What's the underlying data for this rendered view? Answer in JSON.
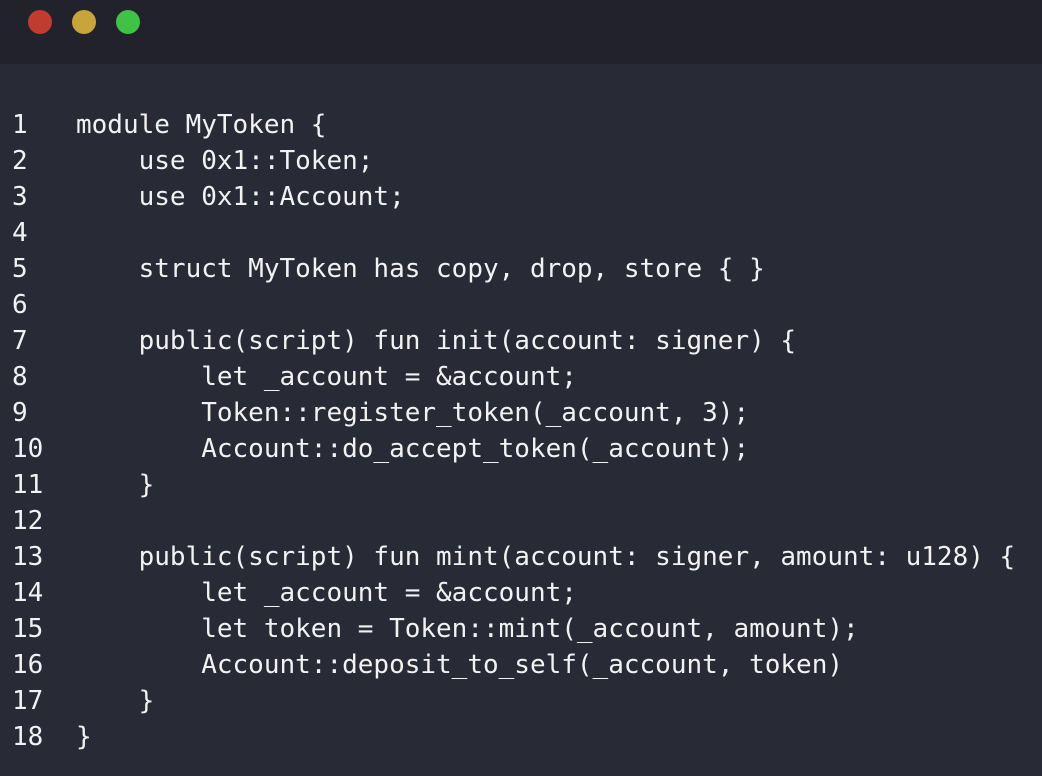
{
  "window": {
    "controls": [
      {
        "name": "close",
        "color": "#c23b30"
      },
      {
        "name": "minimize",
        "color": "#c9a43b"
      },
      {
        "name": "maximize",
        "color": "#3fc245"
      }
    ]
  },
  "code": {
    "lines": [
      {
        "number": "1",
        "text": "module MyToken {"
      },
      {
        "number": "2",
        "text": "    use 0x1::Token;"
      },
      {
        "number": "3",
        "text": "    use 0x1::Account;"
      },
      {
        "number": "4",
        "text": ""
      },
      {
        "number": "5",
        "text": "    struct MyToken has copy, drop, store { }"
      },
      {
        "number": "6",
        "text": ""
      },
      {
        "number": "7",
        "text": "    public(script) fun init(account: signer) {"
      },
      {
        "number": "8",
        "text": "        let _account = &account;"
      },
      {
        "number": "9",
        "text": "        Token::register_token(_account, 3);"
      },
      {
        "number": "10",
        "text": "        Account::do_accept_token(_account);"
      },
      {
        "number": "11",
        "text": "    }"
      },
      {
        "number": "12",
        "text": ""
      },
      {
        "number": "13",
        "text": "    public(script) fun mint(account: signer, amount: u128) {"
      },
      {
        "number": "14",
        "text": "        let _account = &account;"
      },
      {
        "number": "15",
        "text": "        let token = Token::mint(_account, amount);"
      },
      {
        "number": "16",
        "text": "        Account::deposit_to_self(_account, token)"
      },
      {
        "number": "17",
        "text": "    }"
      },
      {
        "number": "18",
        "text": "}"
      }
    ]
  },
  "colors": {
    "background": "#282a36",
    "titlebar": "#21222c",
    "text": "#f2f2f2"
  }
}
